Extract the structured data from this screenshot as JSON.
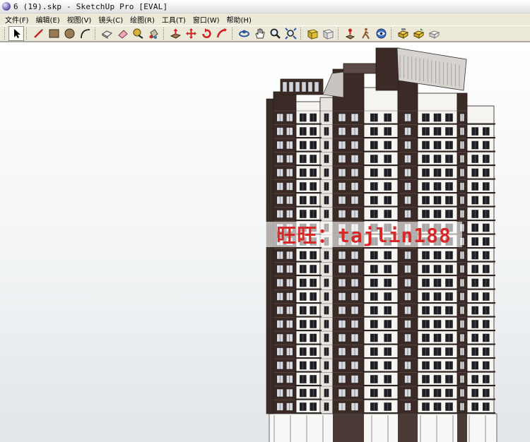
{
  "window": {
    "title": "6 (19).skp - SketchUp Pro [EVAL]"
  },
  "menu": [
    {
      "id": "file",
      "label": "文件(F)"
    },
    {
      "id": "edit",
      "label": "编辑(E)"
    },
    {
      "id": "view",
      "label": "视图(V)"
    },
    {
      "id": "camera",
      "label": "镜头(C)"
    },
    {
      "id": "draw",
      "label": "绘图(R)"
    },
    {
      "id": "tools",
      "label": "工具(T)"
    },
    {
      "id": "window",
      "label": "窗口(W)"
    },
    {
      "id": "help",
      "label": "帮助(H)"
    }
  ],
  "toolbar": {
    "tools": [
      "select-icon",
      "line-icon",
      "rectangle-icon",
      "circle-icon",
      "arc-icon",
      "make-component-icon",
      "eraser-icon",
      "tape-measure-icon",
      "paint-bucket-icon",
      "push-pull-icon",
      "move-icon",
      "rotate-icon",
      "follow-me-icon",
      "orbit-icon",
      "pan-icon",
      "zoom-icon",
      "zoom-extents-icon",
      "previous-view-icon",
      "next-view-icon",
      "position-camera-icon",
      "walk-icon",
      "look-around-icon",
      "get-models-icon",
      "share-model-icon",
      "share-component-icon"
    ],
    "active_tool": "select-icon"
  },
  "viewport": {
    "watermark": "旺旺：tajlin188",
    "colors": {
      "dark_facade": "#3c2a26",
      "light_facade": "#f6f4f1",
      "window": "#1e1e24"
    }
  }
}
